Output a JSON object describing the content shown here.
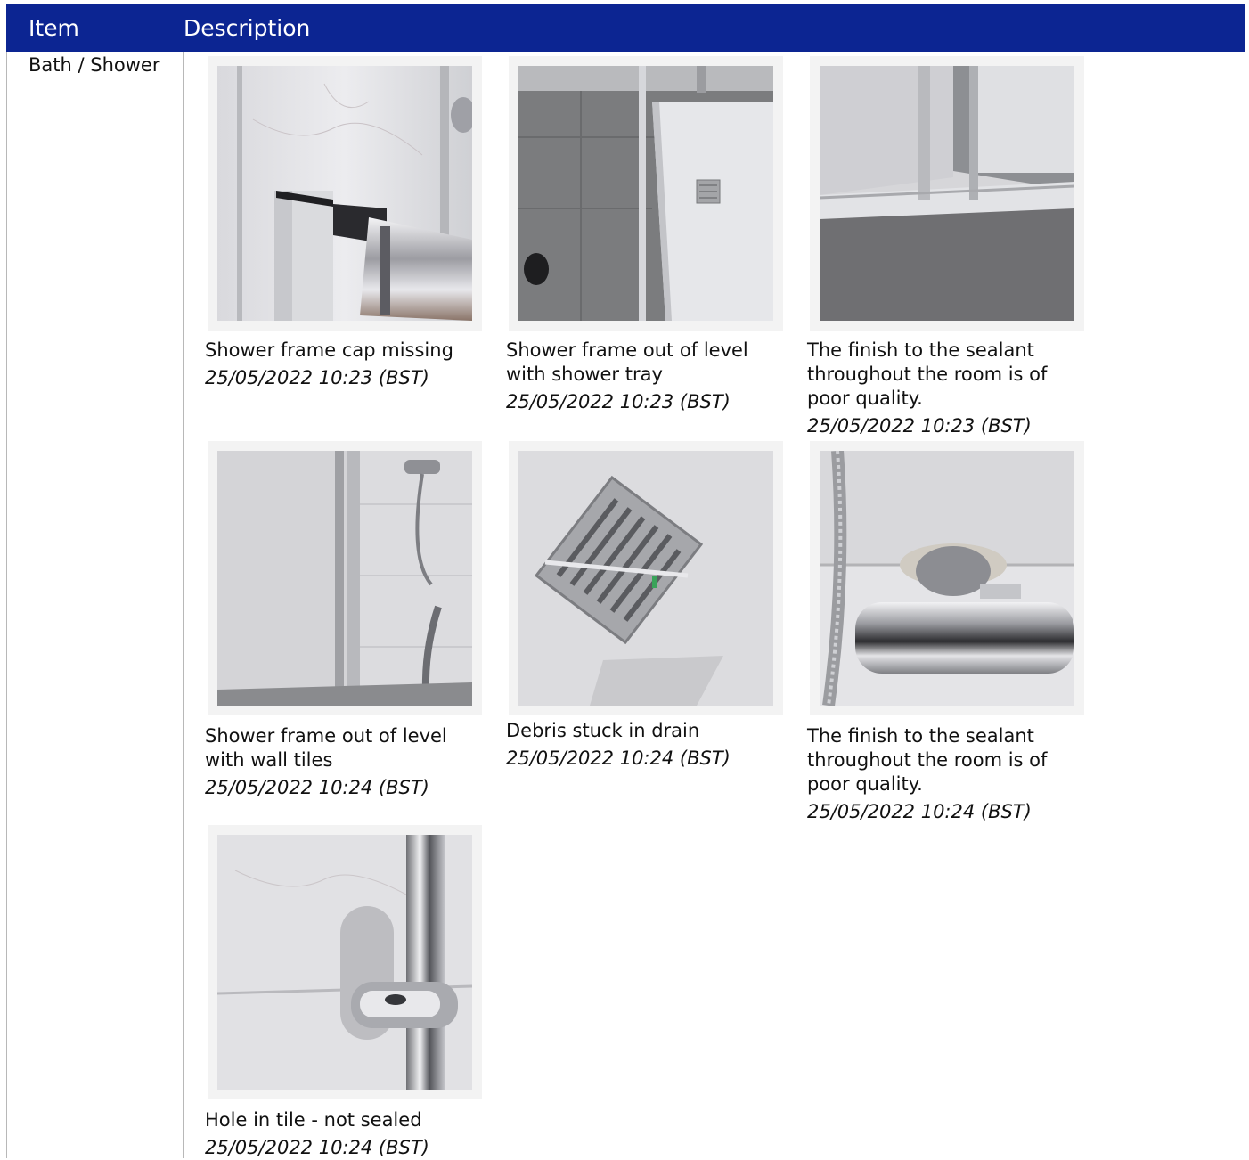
{
  "table": {
    "headers": {
      "item": "Item",
      "description": "Description"
    },
    "rows": [
      {
        "item": "Bath / Shower",
        "photos": [
          {
            "caption": "Shower frame cap missing",
            "timestamp": "25/05/2022 10:23 (BST)",
            "image": "shower-frame-cap-photo"
          },
          {
            "caption": "Shower frame out of level with shower tray",
            "timestamp": "25/05/2022 10:23 (BST)",
            "image": "shower-tray-photo"
          },
          {
            "caption": "The finish to the sealant throughout the room is of poor quality.",
            "timestamp": "25/05/2022 10:23 (BST)",
            "image": "sealant-corner-photo"
          },
          {
            "caption": "Shower frame out of level with wall tiles",
            "timestamp": "25/05/2022 10:24 (BST)",
            "image": "shower-frame-wall-photo"
          },
          {
            "caption": "Debris stuck in drain",
            "timestamp": "25/05/2022 10:24 (BST)",
            "image": "drain-cover-photo"
          },
          {
            "caption": "The finish to the sealant throughout the room is of poor quality.",
            "timestamp": "25/05/2022 10:24 (BST)",
            "image": "shower-valve-photo"
          },
          {
            "caption": "Hole in tile - not sealed",
            "timestamp": "25/05/2022 10:24 (BST)",
            "image": "riser-rail-bracket-photo"
          }
        ]
      }
    ]
  },
  "colors": {
    "header_bg": "#0c2592",
    "header_text": "#ffffff",
    "grid_line": "#b8b8b8"
  }
}
